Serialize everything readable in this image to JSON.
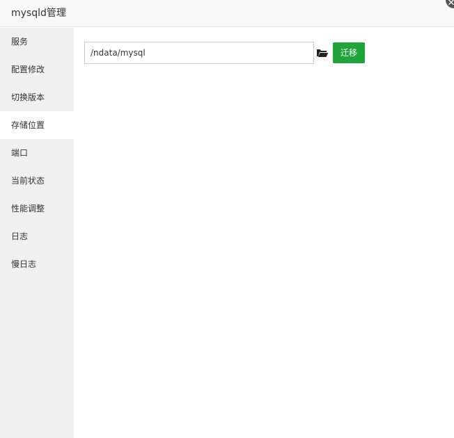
{
  "window": {
    "title": "mysqld管理",
    "close_icon": "close-icon"
  },
  "sidebar": {
    "active_index": 3,
    "items": [
      {
        "label": "服务"
      },
      {
        "label": "配置修改"
      },
      {
        "label": "切换版本"
      },
      {
        "label": "存储位置"
      },
      {
        "label": "端口"
      },
      {
        "label": "当前状态"
      },
      {
        "label": "性能调整"
      },
      {
        "label": "日志"
      },
      {
        "label": "慢日志"
      }
    ]
  },
  "main": {
    "path_value": "/ndata/mysql",
    "folder_icon": "folder-open-icon",
    "migrate_label": "迁移"
  },
  "colors": {
    "accent": "#20a53a",
    "sidebar_bg": "#f0f0f0",
    "titlebar_bg": "#f8f8f8"
  }
}
